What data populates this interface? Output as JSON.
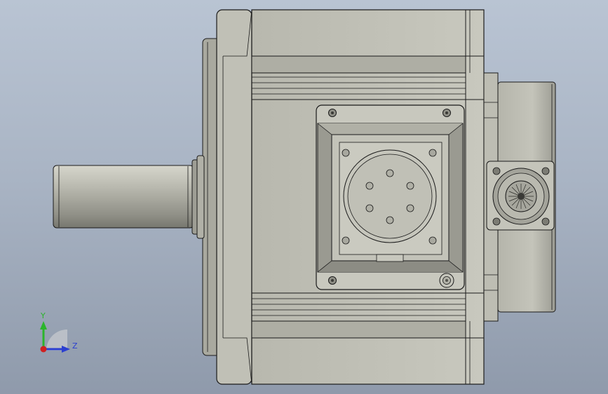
{
  "view": {
    "background_top": "#b9c4d3",
    "background_bottom": "#8f9aab",
    "body_color": "#c3c3b9",
    "body_dark": "#a7a79d",
    "shaft_color": "#a9a99f",
    "edge_color": "#1a1a1a"
  },
  "triad": {
    "y_label": "Y",
    "z_label": "Z",
    "y_color": "#2bb52b",
    "z_color": "#2b3fd0",
    "x_color": "#d02020"
  }
}
